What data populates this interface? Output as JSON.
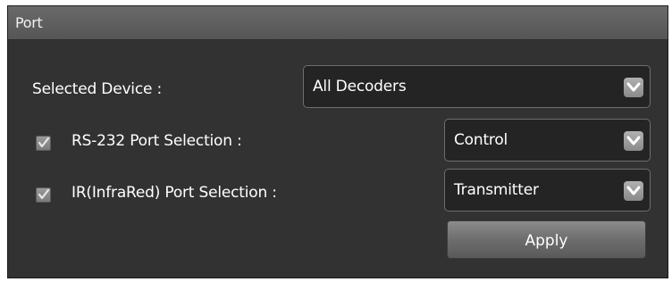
{
  "panel": {
    "title": "Port"
  },
  "selected_device": {
    "label": "Selected Device :",
    "value": "All Decoders"
  },
  "rs232": {
    "checked": true,
    "label": "RS-232 Port Selection :",
    "value": "Control"
  },
  "ir": {
    "checked": true,
    "label": "IR(InfraRed) Port Selection :",
    "value": "Transmitter"
  },
  "apply": {
    "label": "Apply"
  },
  "icons": {
    "dropdown": "chevron-down-icon",
    "checkbox": "checkmark-icon"
  }
}
